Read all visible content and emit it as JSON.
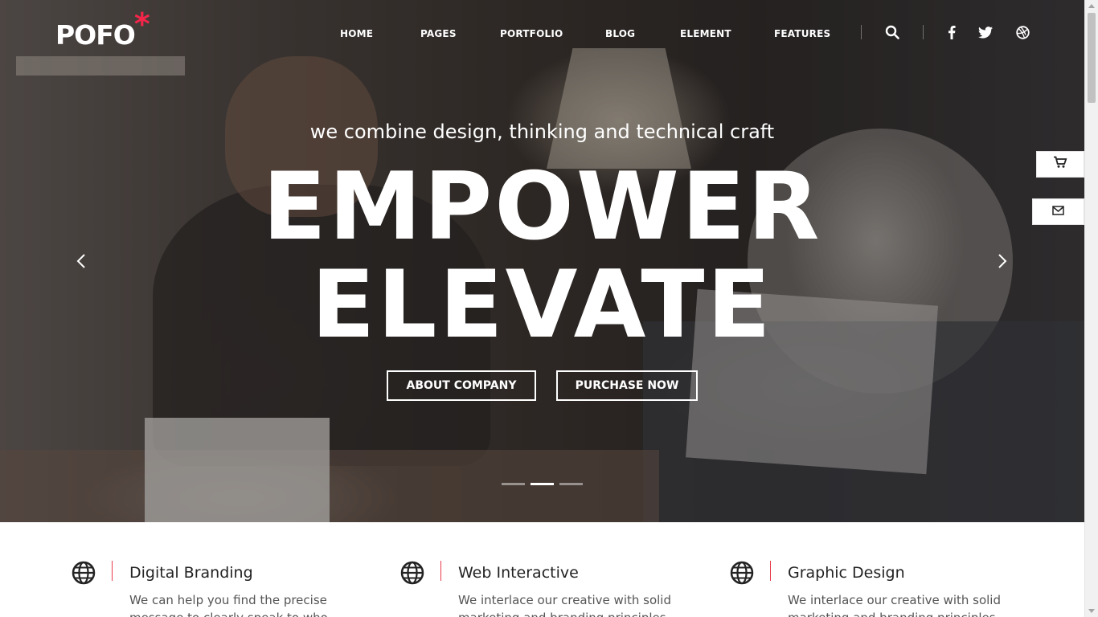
{
  "header": {
    "logo_text": "POFO",
    "logo_mark": "*",
    "nav": [
      "HOME",
      "PAGES",
      "PORTFOLIO",
      "BLOG",
      "ELEMENT",
      "FEATURES"
    ],
    "icons": [
      "search-icon",
      "facebook-icon",
      "twitter-icon",
      "dribbble-icon"
    ]
  },
  "hero": {
    "tagline": "we combine design, thinking and technical craft",
    "headline_1": "EMPOWER",
    "headline_2": "ELEVATE",
    "button_1": "ABOUT COMPANY",
    "button_2": "PURCHASE NOW",
    "slides_total": 3,
    "active_slide": 2
  },
  "side_widgets": [
    "cart-icon",
    "mail-icon"
  ],
  "features": [
    {
      "title": "Digital Branding",
      "text": "We can help you find the precise message to clearly speak to who you"
    },
    {
      "title": "Web Interactive",
      "text": "We interlace our creative with solid marketing and branding principles. A"
    },
    {
      "title": "Graphic Design",
      "text": "We interlace our creative with solid marketing and branding principles. A"
    }
  ],
  "colors": {
    "accent": "#f5254a",
    "feature_line": "#e83a4b",
    "text_dark": "#232323"
  }
}
